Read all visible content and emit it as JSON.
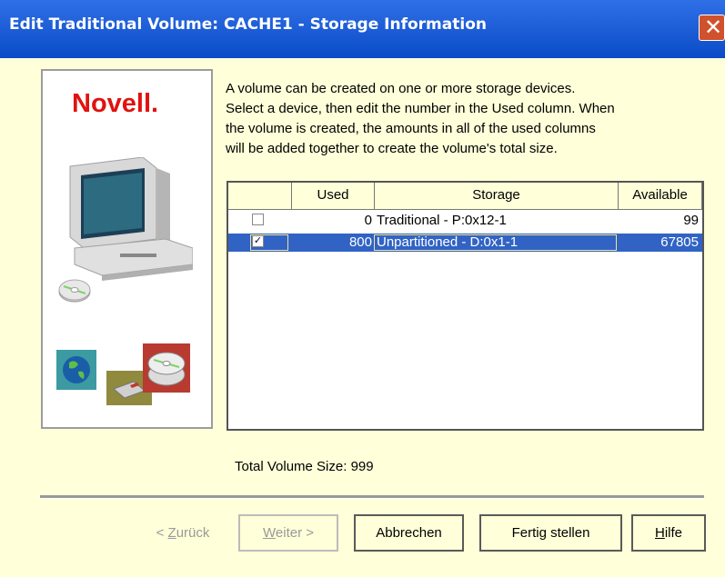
{
  "window": {
    "title": "Edit Traditional Volume: CACHE1 - Storage Information",
    "close_symbol": "✕"
  },
  "logo": {
    "brand": "Novell",
    "registered": "."
  },
  "description": {
    "lines": [
      "A volume can be created on one or more storage devices.",
      "Select a device, then edit the number in the Used column. When",
      "the volume is created, the amounts in all of the used columns",
      "will be added together to create the volume's total size."
    ]
  },
  "table": {
    "headers": {
      "select": "",
      "used": "Used",
      "storage": "Storage",
      "available": "Available"
    },
    "rows": [
      {
        "checked": false,
        "check_mark": "",
        "used": "0",
        "storage": "Traditional - P:0x12-1",
        "available": "99"
      },
      {
        "checked": true,
        "check_mark": "✓",
        "used": "800",
        "storage": "Unpartitioned - D:0x1-1",
        "available": "67805"
      }
    ]
  },
  "total": {
    "text": "Total Volume Size: 999"
  },
  "buttons": {
    "back": {
      "prefix": "< ",
      "mnemonic": "Z",
      "rest": "urück"
    },
    "next": {
      "mnemonic": "W",
      "rest": "eiter >"
    },
    "cancel": "Abbrechen",
    "finish": "Fertig stellen",
    "help": {
      "mnemonic": "H",
      "rest": "ilfe"
    }
  },
  "colors": {
    "titlebar": "#0a4cc8",
    "background": "#ffffd9",
    "selection": "#3163c5",
    "novell_red": "#e1120f"
  },
  "icons": [
    "computer-icon",
    "cd-disc-icon",
    "globe-icon",
    "floppy-disk-icon",
    "cd-stack-icon"
  ]
}
